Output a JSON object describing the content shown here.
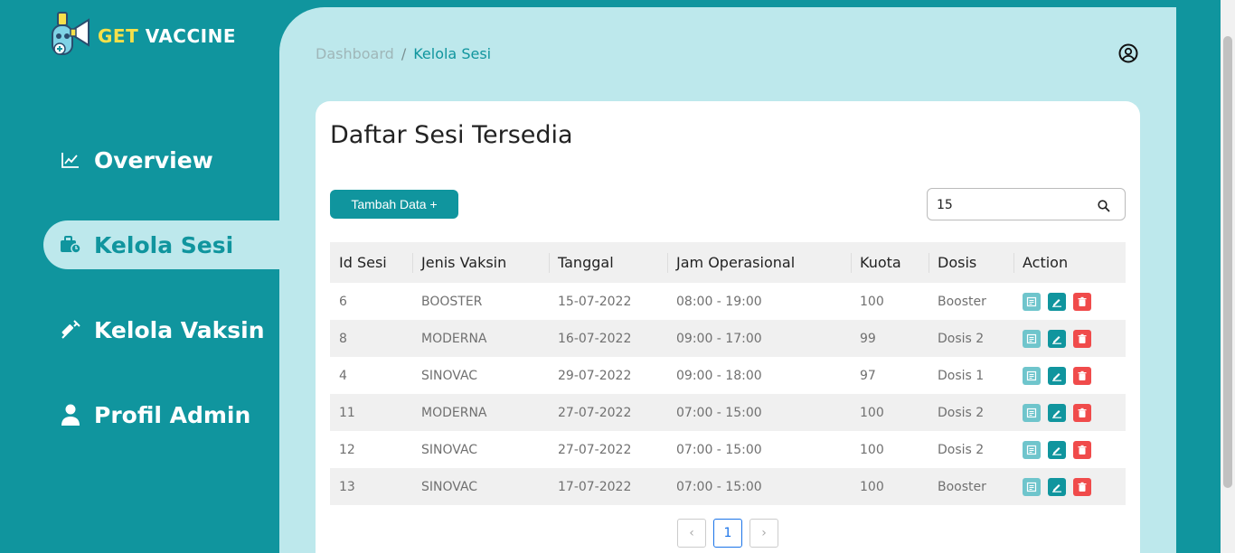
{
  "brand": {
    "part1": "GET",
    "part2": "VACCINE",
    "colors": {
      "get": "#f6e04a",
      "vaccine": "#ffffff"
    }
  },
  "sidebar": {
    "items": [
      {
        "label": "Overview",
        "icon": "chart-line-icon",
        "active": false
      },
      {
        "label": "Kelola Sesi",
        "icon": "briefcase-clock-icon",
        "active": true
      },
      {
        "label": "Kelola Vaksin",
        "icon": "syringe-icon",
        "active": false
      },
      {
        "label": "Profil Admin",
        "icon": "user-icon",
        "active": false
      }
    ]
  },
  "breadcrumb": {
    "parent": "Dashboard",
    "separator": "/",
    "current": "Kelola Sesi"
  },
  "header": {
    "account_icon": "user-circle-icon"
  },
  "card": {
    "title": "Daftar Sesi Tersedia"
  },
  "toolbar": {
    "add_label": "Tambah Data +"
  },
  "search": {
    "value": "15",
    "icon": "search-icon"
  },
  "table": {
    "columns": [
      "Id Sesi",
      "Jenis Vaksin",
      "Tanggal",
      "Jam Operasional",
      "Kuota",
      "Dosis",
      "Action"
    ],
    "rows": [
      [
        "6",
        "BOOSTER",
        "15-07-2022",
        "08:00 - 19:00",
        "100",
        "Booster"
      ],
      [
        "8",
        "MODERNA",
        "16-07-2022",
        "09:00 - 17:00",
        "99",
        "Dosis 2"
      ],
      [
        "4",
        "SINOVAC",
        "29-07-2022",
        "09:00 - 18:00",
        "97",
        "Dosis 1"
      ],
      [
        "11",
        "MODERNA",
        "27-07-2022",
        "07:00 - 15:00",
        "100",
        "Dosis 2"
      ],
      [
        "12",
        "SINOVAC",
        "27-07-2022",
        "07:00 - 15:00",
        "100",
        "Dosis 2"
      ],
      [
        "13",
        "SINOVAC",
        "17-07-2022",
        "07:00 - 15:00",
        "100",
        "Booster"
      ]
    ],
    "action_icons": [
      "detail-icon",
      "edit-icon",
      "delete-icon"
    ]
  },
  "pagination": {
    "prev": "‹",
    "current": "1",
    "next": "›"
  },
  "colors": {
    "primary": "#10959e",
    "panel": "#bde8ec",
    "danger": "#f04b4b",
    "detail": "#6fc5cc"
  }
}
